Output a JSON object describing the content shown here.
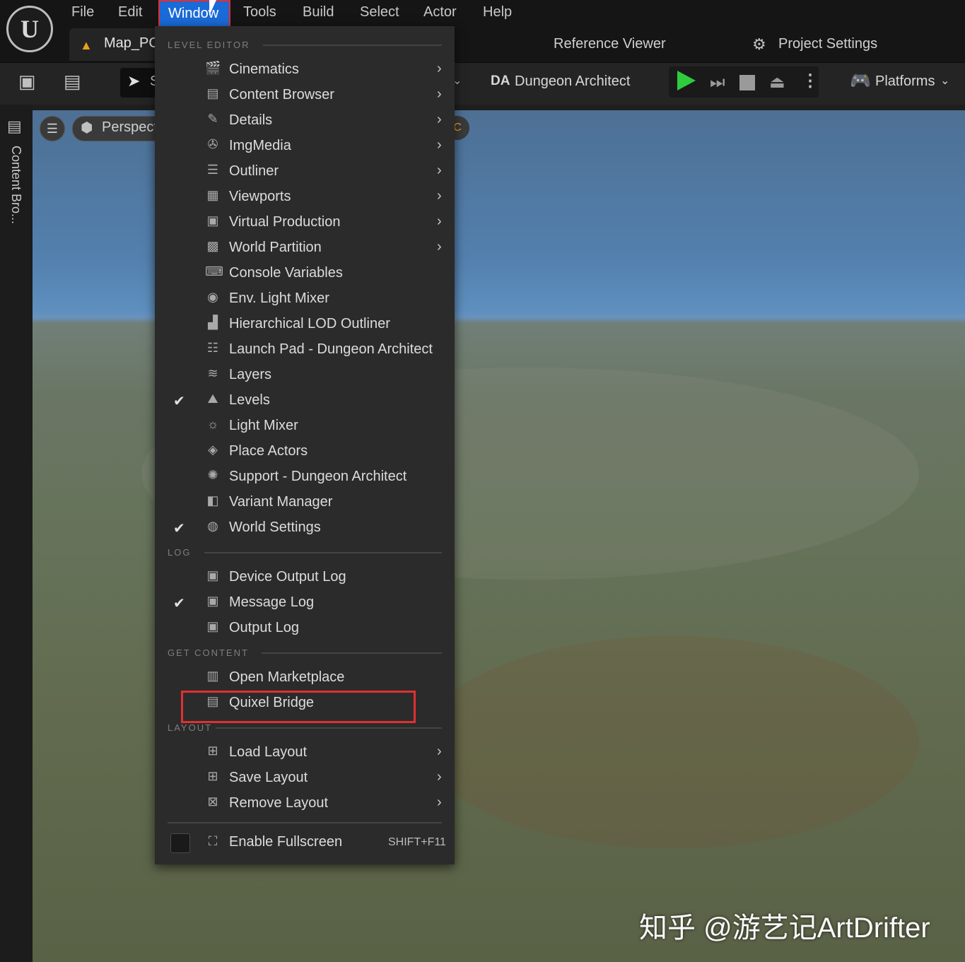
{
  "app": {
    "logo_label": "U",
    "menu": [
      "File",
      "Edit",
      "Window",
      "Tools",
      "Build",
      "Select",
      "Actor",
      "Help"
    ],
    "active_menu": "Window",
    "tab": {
      "label": "Map_PC"
    },
    "top_links": {
      "reference_viewer": "Reference Viewer",
      "project_settings": "Project Settings"
    },
    "toolbar": {
      "mode_initial": "S",
      "dungeon_architect": "Dungeon Architect",
      "dungeon_badge": "DA",
      "platforms": "Platforms"
    },
    "sidebar": {
      "content_browser": "Content Bro..."
    },
    "viewport": {
      "perspective": "Perspect",
      "right_pill": "C"
    },
    "watermark": "知乎 @游艺记ArtDrifter",
    "colors": {
      "accent": "#1a6ad8",
      "highlight_border": "#e03030",
      "play": "#2fcc3d"
    }
  },
  "dropdown": {
    "sections": {
      "level_editor": "LEVEL EDITOR",
      "log": "LOG",
      "get_content": "GET CONTENT",
      "layout": "LAYOUT"
    },
    "level_editor_items": [
      {
        "label": "Cinematics",
        "icon": "clapper-icon",
        "glyph": "🎬",
        "submenu": true,
        "checked": false
      },
      {
        "label": "Content Browser",
        "icon": "folder-search-icon",
        "glyph": "▤",
        "submenu": true,
        "checked": false
      },
      {
        "label": "Details",
        "icon": "pencil-icon",
        "glyph": "✎",
        "submenu": true,
        "checked": false
      },
      {
        "label": "ImgMedia",
        "icon": "film-reel-icon",
        "glyph": "✇",
        "submenu": true,
        "checked": false
      },
      {
        "label": "Outliner",
        "icon": "outliner-icon",
        "glyph": "☰",
        "submenu": true,
        "checked": false
      },
      {
        "label": "Viewports",
        "icon": "viewports-icon",
        "glyph": "▦",
        "submenu": true,
        "checked": false
      },
      {
        "label": "Virtual Production",
        "icon": "camera-person-icon",
        "glyph": "▣",
        "submenu": true,
        "checked": false
      },
      {
        "label": "World Partition",
        "icon": "grid-icon",
        "glyph": "▩",
        "submenu": true,
        "checked": false
      },
      {
        "label": "Console Variables",
        "icon": "console-icon",
        "glyph": "⌨",
        "submenu": false,
        "checked": false
      },
      {
        "label": "Env. Light Mixer",
        "icon": "light-mixer-icon",
        "glyph": "◉",
        "submenu": false,
        "checked": false
      },
      {
        "label": "Hierarchical LOD Outliner",
        "icon": "lod-icon",
        "glyph": "▟",
        "submenu": false,
        "checked": false
      },
      {
        "label": "Launch Pad - Dungeon Architect",
        "icon": "launchpad-icon",
        "glyph": "☷",
        "submenu": false,
        "checked": false
      },
      {
        "label": "Layers",
        "icon": "layers-icon",
        "glyph": "≋",
        "submenu": false,
        "checked": false
      },
      {
        "label": "Levels",
        "icon": "levels-icon",
        "glyph": "⛰",
        "submenu": false,
        "checked": true
      },
      {
        "label": "Light Mixer",
        "icon": "sun-icon",
        "glyph": "☼",
        "submenu": false,
        "checked": false
      },
      {
        "label": "Place Actors",
        "icon": "place-actors-icon",
        "glyph": "◈",
        "submenu": false,
        "checked": false
      },
      {
        "label": "Support - Dungeon Architect",
        "icon": "support-icon",
        "glyph": "✺",
        "submenu": false,
        "checked": false
      },
      {
        "label": "Variant Manager",
        "icon": "variant-icon",
        "glyph": "◧",
        "submenu": false,
        "checked": false
      },
      {
        "label": "World Settings",
        "icon": "globe-icon",
        "glyph": "◍",
        "submenu": false,
        "checked": true
      }
    ],
    "log_items": [
      {
        "label": "Device Output Log",
        "icon": "log-icon",
        "glyph": "▣",
        "checked": false
      },
      {
        "label": "Message Log",
        "icon": "message-log-icon",
        "glyph": "▣",
        "checked": true
      },
      {
        "label": "Output Log",
        "icon": "output-log-icon",
        "glyph": "▣",
        "checked": false
      }
    ],
    "content_items": [
      {
        "label": "Open Marketplace",
        "icon": "marketplace-icon",
        "glyph": "▥"
      },
      {
        "label": "Quixel Bridge",
        "icon": "bridge-icon",
        "glyph": "▤"
      }
    ],
    "layout_items": [
      {
        "label": "Load Layout",
        "icon": "load-layout-icon",
        "glyph": "⊞"
      },
      {
        "label": "Save Layout",
        "icon": "save-layout-icon",
        "glyph": "⊞"
      },
      {
        "label": "Remove Layout",
        "icon": "remove-layout-icon",
        "glyph": "⊠"
      }
    ],
    "fullscreen": {
      "label": "Enable Fullscreen",
      "shortcut": "SHIFT+F11",
      "icon": "fullscreen-icon",
      "glyph": "⛶",
      "checked": false
    }
  }
}
